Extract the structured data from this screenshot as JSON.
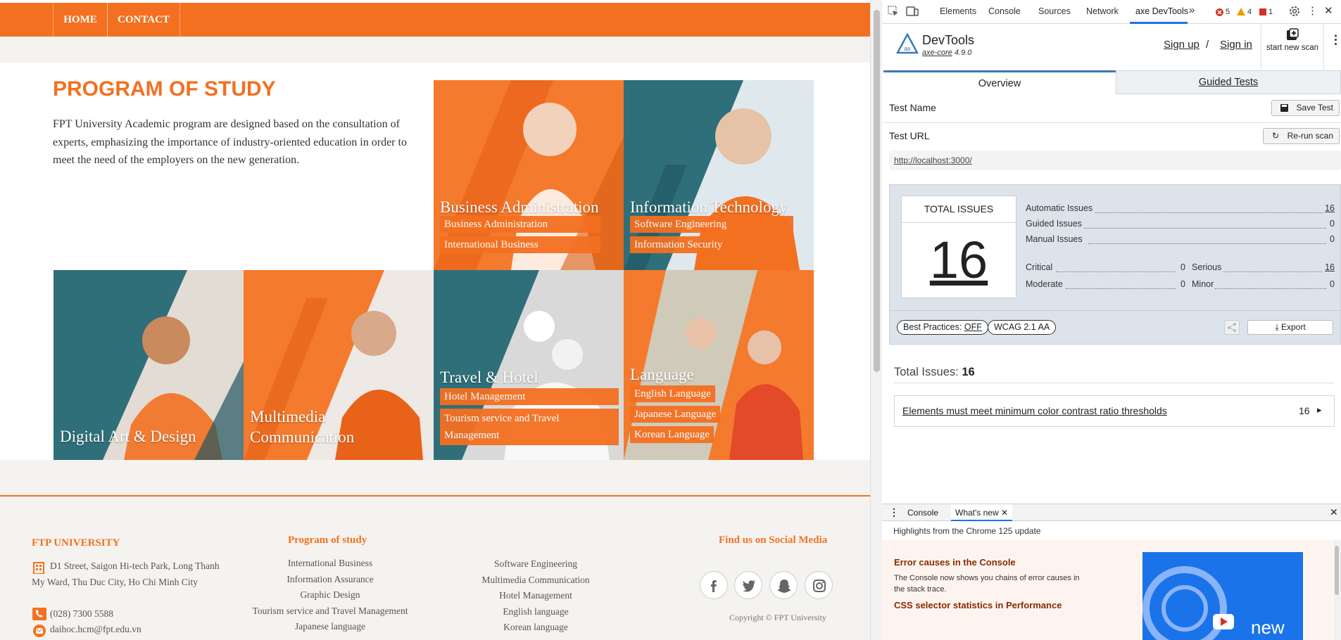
{
  "site": {
    "nav": [
      "HOME",
      "CONTACT"
    ],
    "program": {
      "title": "PROGRAM OF STUDY",
      "description": "FPT University Academic program are designed based on the consultation of experts, emphasizing the importance of industry-oriented education in order to meet the need of the employers on the new generation."
    },
    "tiles": [
      {
        "title": "Business Administration",
        "tags": [
          "Business Administration",
          "International Business"
        ]
      },
      {
        "title": "Information Technology",
        "tags": [
          "Software Engineering",
          "Information Security"
        ]
      },
      {
        "title": "Digital Art & Design",
        "tags": []
      },
      {
        "title": "Multimedia Communication",
        "tags": []
      },
      {
        "title": "Travel & Hotel",
        "tags": [
          "Hotel Management",
          "Tourism service and Travel Management"
        ]
      },
      {
        "title": "Language",
        "tags": [
          "English Language",
          "Japanese Language",
          "Korean Language"
        ]
      }
    ],
    "footer": {
      "university": "FTP UNIVERSITY",
      "address": "D1 Street, Saigon Hi-tech Park, Long Thanh My Ward, Thu Duc City, Ho Chi Minh City",
      "phone": "(028) 7300 5588",
      "email": "daihoc.hcm@fpt.edu.vn",
      "program_heading": "Program of study",
      "program_col1": [
        "International Business",
        "Information Assurance",
        "Graphic Design",
        "Tourism service and Travel Management",
        "Japanese language"
      ],
      "program_col2": [
        "Software Engineering",
        "Multimedia Communication",
        "Hotel Management",
        "English language",
        "Korean language"
      ],
      "social_heading": "Find us on Social Media",
      "social_icons": [
        "facebook-icon",
        "twitter-icon",
        "snapchat-icon",
        "instagram-icon"
      ],
      "copyright": "Copyright © FPT University"
    }
  },
  "devtools": {
    "tabs": [
      "Elements",
      "Console",
      "Sources",
      "Network",
      "axe DevTools"
    ],
    "active_tab": "axe DevTools",
    "errors": "5",
    "warnings": "4",
    "info": "1",
    "axe": {
      "brand": "DevTools",
      "core": "axe-core",
      "version": "4.9.0",
      "signup": "Sign up",
      "separator": "/",
      "signin": "Sign in",
      "start_scan": "start new scan",
      "tabs": [
        "Overview",
        "Guided Tests"
      ],
      "test_name_label": "Test Name",
      "save_test": "Save Test",
      "test_url_label": "Test URL",
      "rerun": "Re-run scan",
      "url": "http://localhost:3000/",
      "total_issues_label": "TOTAL ISSUES",
      "total_issues": "16",
      "automatic_label": "Automatic Issues",
      "automatic": "16",
      "guided_label": "Guided Issues",
      "guided": "0",
      "manual_label": "Manual Issues",
      "manual": "0",
      "critical_label": "Critical",
      "critical": "0",
      "serious_label": "Serious",
      "serious": "16",
      "moderate_label": "Moderate",
      "moderate": "0",
      "minor_label": "Minor",
      "minor": "0",
      "best_practices_label": "Best Practices:",
      "best_practices_value": "OFF",
      "wcag": "WCAG 2.1 AA",
      "export": "Export",
      "total_label": "Total Issues:",
      "total_value": "16",
      "issue_title": "Elements must meet minimum color contrast ratio thresholds",
      "issue_count": "16"
    },
    "drawer": {
      "tabs": [
        "Console",
        "What's new"
      ],
      "highlights": "Highlights from the Chrome 125 update",
      "item1_title": "Error causes in the Console",
      "item1_desc": "The Console now shows you chains of error causes in the stack trace.",
      "item2_title": "CSS selector statistics in Performance",
      "video_word": "new"
    }
  },
  "colors": {
    "brand_orange": "#f37021",
    "teal": "#2f6f7a",
    "axe_blue": "#3a79b8"
  }
}
